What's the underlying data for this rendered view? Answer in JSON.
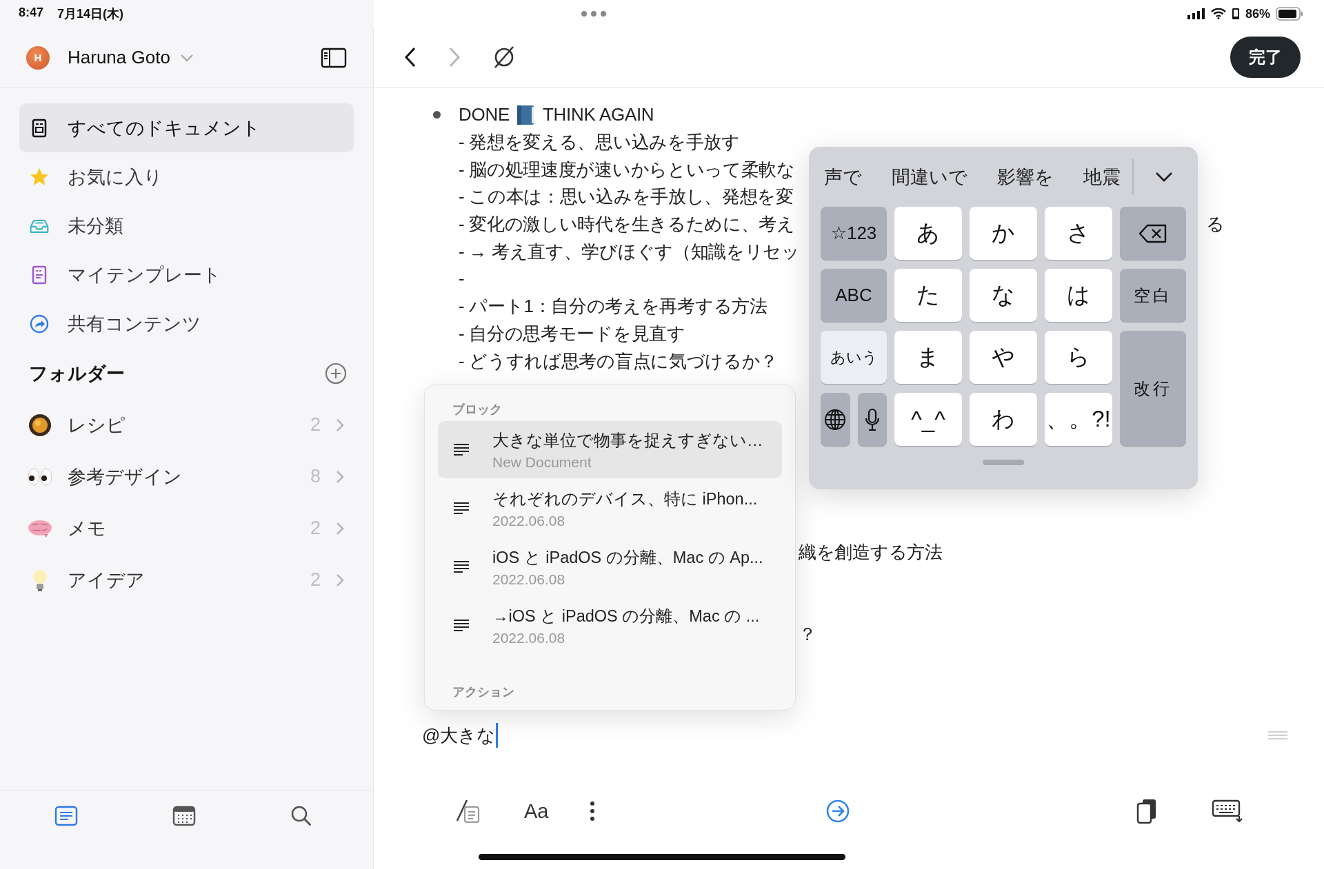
{
  "status_bar": {
    "time": "8:47",
    "date": "7月14日(木)",
    "battery": "86%"
  },
  "sidebar": {
    "account": {
      "avatar": "H",
      "name": "Haruna Goto"
    },
    "nav": [
      {
        "label": "すべてのドキュメント",
        "kind": "document",
        "selected": true
      },
      {
        "label": "お気に入り",
        "kind": "star",
        "selected": false
      },
      {
        "label": "未分類",
        "kind": "inbox",
        "selected": false
      },
      {
        "label": "マイテンプレート",
        "kind": "template",
        "selected": false
      },
      {
        "label": "共有コンテンツ",
        "kind": "shared",
        "selected": false
      }
    ],
    "folders_title": "フォルダー",
    "folders": [
      {
        "name": "レシピ",
        "kind": "pan",
        "count": "2"
      },
      {
        "name": "参考デザイン",
        "kind": "eyes",
        "count": "8"
      },
      {
        "name": "メモ",
        "kind": "brain",
        "count": "2"
      },
      {
        "name": "アイデア",
        "kind": "bulb",
        "count": "2"
      }
    ],
    "tabs": [
      {
        "kind": "documents",
        "selected": true
      },
      {
        "kind": "calendar",
        "selected": false
      },
      {
        "kind": "search",
        "selected": false
      }
    ]
  },
  "toolbar": {
    "forward_disabled": true,
    "done": "完了"
  },
  "editor": {
    "lines": [
      {
        "kind": "heading",
        "status": "DONE",
        "title": "THINK AGAIN"
      },
      {
        "kind": "text",
        "text": "- 発想を変える、思い込みを手放す"
      },
      {
        "kind": "text",
        "text": "- 脳の処理速度が速いからといって柔軟な"
      },
      {
        "kind": "text",
        "text": "- この本は：思い込みを手放し、発想を変"
      },
      {
        "kind": "text",
        "text": "- 変化の激しい時代を生きるために、考え",
        "tail": "る"
      },
      {
        "kind": "text",
        "text": "- → 考え直す、学びほぐす（知識をリセッ"
      },
      {
        "kind": "text",
        "text": "-"
      },
      {
        "kind": "text",
        "text": "- パート1：自分の考えを再考する方法"
      },
      {
        "kind": "text",
        "text": "- 自分の思考モードを見直す"
      },
      {
        "kind": "text",
        "text": "- どうすれば思考の盲点に気づけるか？"
      },
      {
        "kind": "fragment",
        "text": "織を創造する方法"
      },
      {
        "kind": "fragment",
        "text": "？"
      }
    ],
    "input": "@大きな",
    "format_label": "Aa"
  },
  "mention_popup": {
    "blocks_title": "ブロック",
    "items": [
      {
        "title": "大きな単位で物事を捉えすぎない…",
        "subtitle": "New Document",
        "selected": true
      },
      {
        "title": "それぞれのデバイス、特に iPhon...",
        "subtitle": "2022.06.08",
        "selected": false
      },
      {
        "title": "iOS と iPadOS の分離、Mac の Ap...",
        "subtitle": "2022.06.08",
        "selected": false
      },
      {
        "title": "→iOS と iPadOS の分離、Mac の ...",
        "subtitle": "2022.06.08",
        "selected": false
      }
    ],
    "actions_title": "アクション"
  },
  "keyboard": {
    "candidates": [
      "声で",
      "間違いで",
      "影響を",
      "地震"
    ],
    "keys": [
      {
        "kind": "mode",
        "label": "☆123",
        "selected": false
      },
      {
        "kind": "kana",
        "label": "あ"
      },
      {
        "kind": "kana",
        "label": "か"
      },
      {
        "kind": "kana",
        "label": "さ"
      },
      {
        "kind": "backspace"
      },
      {
        "kind": "mode",
        "label": "ABC",
        "selected": false
      },
      {
        "kind": "kana",
        "label": "た"
      },
      {
        "kind": "kana",
        "label": "な"
      },
      {
        "kind": "kana",
        "label": "は"
      },
      {
        "kind": "space",
        "label": "空白"
      },
      {
        "kind": "mode",
        "label": "あいう",
        "selected": true
      },
      {
        "kind": "kana",
        "label": "ま"
      },
      {
        "kind": "kana",
        "label": "や"
      },
      {
        "kind": "kana",
        "label": "ら"
      },
      {
        "kind": "return",
        "label": "改行"
      },
      {
        "kind": "globe"
      },
      {
        "kind": "mic"
      },
      {
        "kind": "kana",
        "label": "^_^"
      },
      {
        "kind": "kana",
        "label": "わ"
      },
      {
        "kind": "kana",
        "label": "、。?!"
      }
    ]
  }
}
